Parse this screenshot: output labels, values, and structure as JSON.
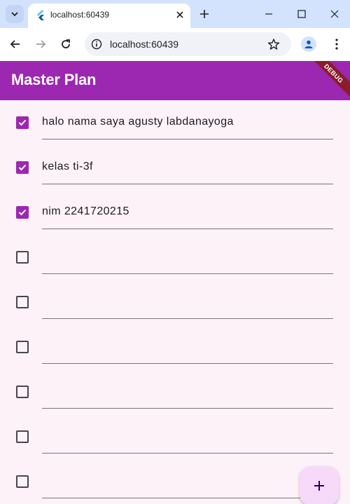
{
  "browser": {
    "tab_title": "localhost:60439",
    "url": "localhost:60439"
  },
  "app": {
    "title": "Master Plan",
    "debug_label": "DEBUG",
    "accent_color": "#9c27b0"
  },
  "tasks": [
    {
      "description": "halo nama saya agusty labdanayoga",
      "completed": true
    },
    {
      "description": "kelas ti-3f",
      "completed": true
    },
    {
      "description": "nim 2241720215",
      "completed": true
    },
    {
      "description": "",
      "completed": false
    },
    {
      "description": "",
      "completed": false
    },
    {
      "description": "",
      "completed": false
    },
    {
      "description": "",
      "completed": false
    },
    {
      "description": "",
      "completed": false
    },
    {
      "description": "",
      "completed": false
    }
  ],
  "fab": {
    "icon": "add-icon"
  }
}
